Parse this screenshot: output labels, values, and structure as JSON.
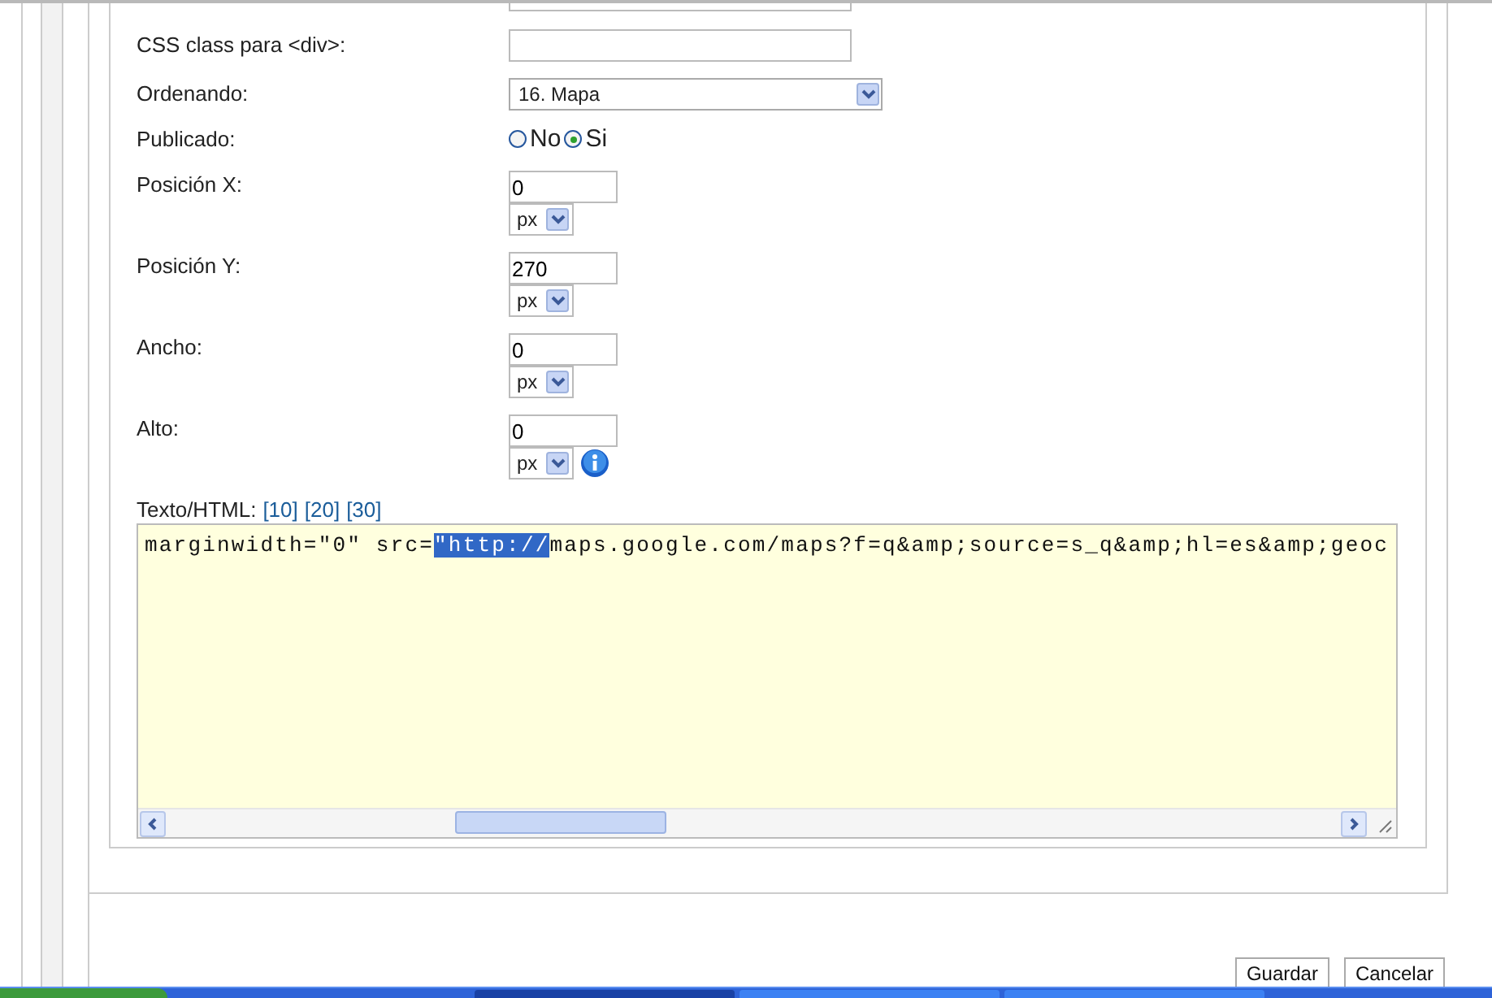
{
  "form": {
    "fields": [
      {
        "label": "CSS class para <div>:",
        "kind": "text"
      },
      {
        "label": "Ordenando:",
        "kind": "select",
        "value": "16. Mapa"
      },
      {
        "label": "Publicado:",
        "kind": "radio",
        "options": [
          {
            "label": "No",
            "selected": false
          },
          {
            "label": "Si",
            "selected": true
          }
        ]
      },
      {
        "label": "Posición X:",
        "kind": "size",
        "value": "0",
        "unit": "px",
        "info": false
      },
      {
        "label": "Posición Y:",
        "kind": "size",
        "value": "270",
        "unit": "px",
        "info": false
      },
      {
        "label": "Ancho:",
        "kind": "size",
        "value": "0",
        "unit": "px",
        "info": false
      },
      {
        "label": "Alto:",
        "kind": "size",
        "value": "0",
        "unit": "px",
        "info": true
      }
    ]
  },
  "editor": {
    "label": "Texto/HTML:",
    "links": [
      "[10]",
      "[20]",
      "[30]"
    ],
    "code_before": "marginwidth=\"0\" src=",
    "code_selected": "\"http://",
    "code_after": "maps.google.com/maps?f=q&amp;source=s_q&amp;hl=es&amp;geoc"
  },
  "buttons": [
    "Guardar",
    "Cancelar"
  ]
}
